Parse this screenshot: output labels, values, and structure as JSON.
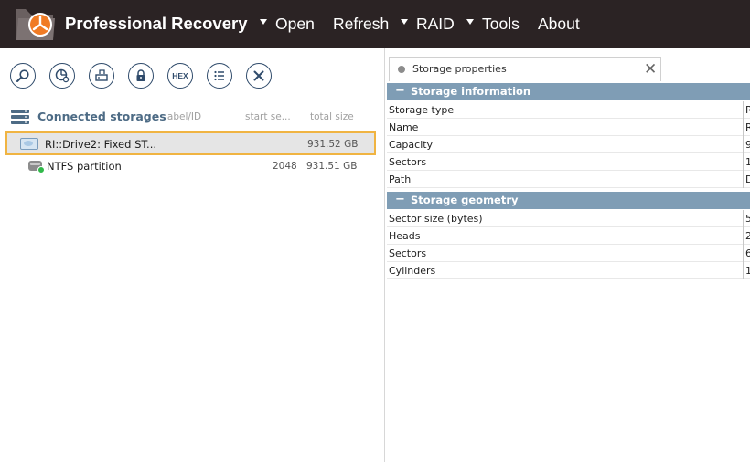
{
  "app": {
    "title": "Professional Recovery"
  },
  "menu": {
    "items": [
      {
        "label": "Open",
        "has_arrow": true
      },
      {
        "label": "Refresh",
        "has_arrow": false
      },
      {
        "label": "RAID",
        "has_arrow": true
      },
      {
        "label": "Tools",
        "has_arrow": true
      },
      {
        "label": "About",
        "has_arrow": false
      }
    ]
  },
  "toolbar": {
    "buttons": [
      {
        "icon": "search-icon"
      },
      {
        "icon": "scan-icon"
      },
      {
        "icon": "image-icon"
      },
      {
        "icon": "lock-icon"
      },
      {
        "icon": "hex-icon",
        "label": "HEX"
      },
      {
        "icon": "list-icon"
      },
      {
        "icon": "close-icon"
      }
    ]
  },
  "storages": {
    "title": "Connected storages",
    "columns": {
      "label": "label/ID",
      "start": "start se...",
      "total": "total size"
    },
    "rows": [
      {
        "name": "RI::Drive2: Fixed ST...",
        "start": "",
        "total": "931.52 GB",
        "selected": true
      },
      {
        "name": "NTFS partition",
        "start": "2048",
        "total": "931.51 GB",
        "selected": false
      }
    ]
  },
  "properties": {
    "tab_label": "Storage properties",
    "sections": [
      {
        "title": "Storage information",
        "toggle": "−",
        "rows": [
          {
            "name": "Storage type",
            "value": "R"
          },
          {
            "name": "Name",
            "value": "R"
          },
          {
            "name": "Capacity",
            "value": "9"
          },
          {
            "name": "Sectors",
            "value": "1"
          },
          {
            "name": "Path",
            "value": "D"
          }
        ]
      },
      {
        "title": "Storage geometry",
        "toggle": "−",
        "rows": [
          {
            "name": "Sector size (bytes)",
            "value": "5"
          },
          {
            "name": "Heads",
            "value": "2"
          },
          {
            "name": "Sectors",
            "value": "6"
          },
          {
            "name": "Cylinders",
            "value": "1"
          }
        ]
      }
    ]
  },
  "colors": {
    "titlebar_bg": "#2b2324",
    "section_bg": "#7f9db5",
    "selection_border": "#f0b442",
    "icon_stroke": "#2f4b6b"
  }
}
